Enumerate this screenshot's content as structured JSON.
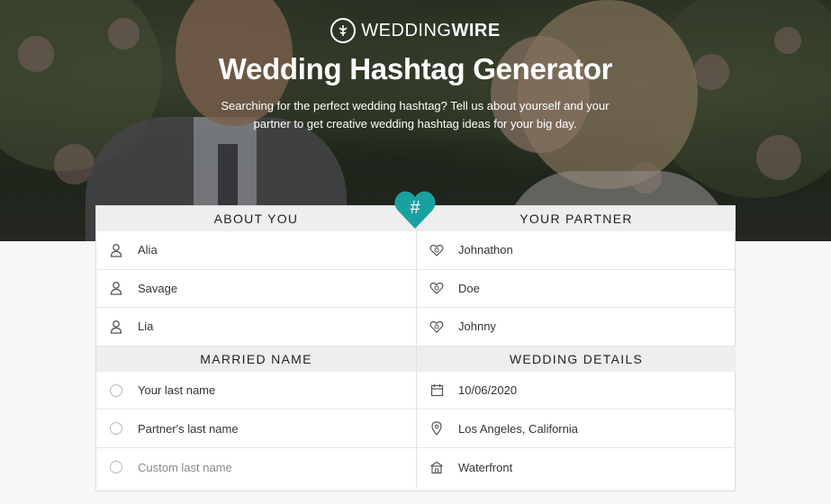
{
  "brand": {
    "name_light": "WEDDING",
    "name_bold": "WIRE"
  },
  "title": "Wedding Hashtag Generator",
  "subtitle": "Searching for the perfect wedding hashtag? Tell us about yourself and your partner to get creative wedding hashtag ideas for your big day.",
  "heart_symbol": "#",
  "accent_color": "#19a1a0",
  "about_you": {
    "heading": "ABOUT YOU",
    "fields": [
      {
        "value": "Alia",
        "icon": "person-icon"
      },
      {
        "value": "Savage",
        "icon": "person-icon"
      },
      {
        "value": "Lia",
        "icon": "person-icon"
      }
    ]
  },
  "your_partner": {
    "heading": "YOUR PARTNER",
    "fields": [
      {
        "value": "Johnathon",
        "icon": "heart-ring-icon"
      },
      {
        "value": "Doe",
        "icon": "heart-ring-icon"
      },
      {
        "value": "Johnny",
        "icon": "heart-ring-icon"
      }
    ]
  },
  "married_name": {
    "heading": "MARRIED NAME",
    "options": [
      {
        "label": "Your last name"
      },
      {
        "label": "Partner's last name"
      },
      {
        "placeholder": "Custom last name"
      }
    ]
  },
  "wedding_details": {
    "heading": "WEDDING DETAILS",
    "fields": [
      {
        "value": "10/06/2020",
        "icon": "calendar-icon"
      },
      {
        "value": "Los Angeles, California",
        "icon": "location-pin-icon"
      },
      {
        "value": "Waterfront",
        "icon": "venue-icon"
      }
    ]
  }
}
